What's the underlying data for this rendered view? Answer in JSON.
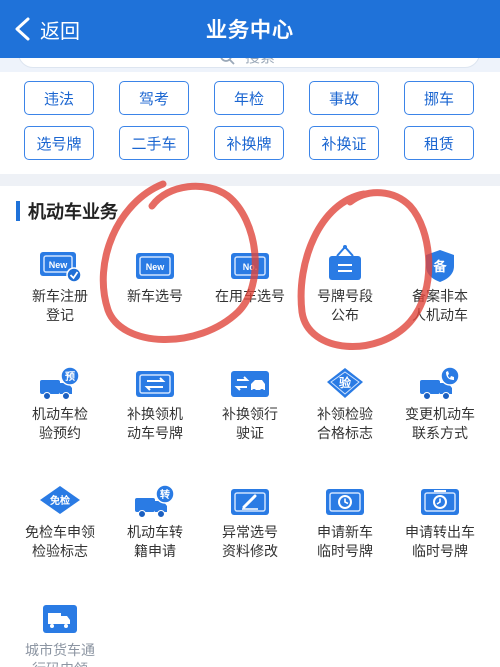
{
  "header": {
    "back_label": "返回",
    "title": "业务中心",
    "bg_color": "#1f72d9"
  },
  "search": {
    "placeholder": "搜索"
  },
  "quick_links": [
    {
      "label": "违法"
    },
    {
      "label": "驾考"
    },
    {
      "label": "年检"
    },
    {
      "label": "事故"
    },
    {
      "label": "挪车"
    },
    {
      "label": "选号牌"
    },
    {
      "label": "二手车"
    },
    {
      "label": "补换牌"
    },
    {
      "label": "补换证"
    },
    {
      "label": "租赁"
    }
  ],
  "section": {
    "title": "机动车业务"
  },
  "services": [
    {
      "label": "新车注册\n登记",
      "icon": "new-plate-check-icon"
    },
    {
      "label": "新车选号",
      "icon": "new-plate-icon"
    },
    {
      "label": "在用车选号",
      "icon": "plate-number-icon"
    },
    {
      "label": "号牌号段\n公布",
      "icon": "hanging-sign-icon"
    },
    {
      "label": "备案非本\n人机动车",
      "icon": "record-shield-icon",
      "icon_text": "备"
    },
    {
      "label": "机动车检\n验预约",
      "icon": "truck-booking-icon",
      "icon_text": "预"
    },
    {
      "label": "补换领机\n动车号牌",
      "icon": "plate-swap-icon"
    },
    {
      "label": "补换领行\n驶证",
      "icon": "license-swap-icon"
    },
    {
      "label": "补领检验\n合格标志",
      "icon": "inspection-badge-icon",
      "icon_text": "验"
    },
    {
      "label": "变更机动车\n联系方式",
      "icon": "truck-phone-icon"
    },
    {
      "label": "免检车申领\n检验标志",
      "icon": "exempt-badge-icon",
      "icon_text": "免检"
    },
    {
      "label": "机动车转\n籍申请",
      "icon": "truck-transfer-icon",
      "icon_text": "转"
    },
    {
      "label": "异常选号\n资料修改",
      "icon": "edit-card-icon"
    },
    {
      "label": "申请新车\n临时号牌",
      "icon": "temp-plate-clock-icon"
    },
    {
      "label": "申请转出车\n临时号牌",
      "icon": "temp-plate-timer-icon"
    },
    {
      "label": "城市货车通\n行码申领",
      "icon": "city-truck-pass-icon"
    }
  ],
  "colors": {
    "accent": "#1f72d9",
    "chip_border": "#3b84e8",
    "annotation_red": "#e0463c"
  }
}
